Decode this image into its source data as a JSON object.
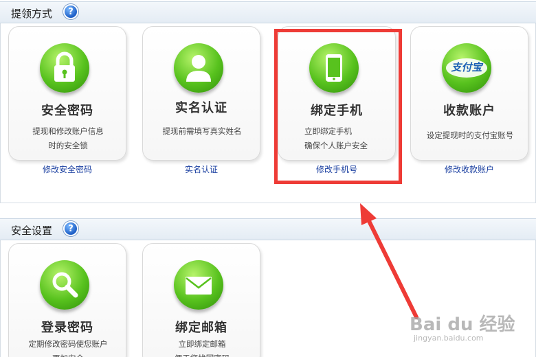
{
  "sections": [
    {
      "title": "提领方式",
      "help": "?",
      "cards": [
        {
          "title": "安全密码",
          "desc": [
            "提现和修改账户信息",
            "时的安全锁"
          ],
          "link": "修改安全密码",
          "icon": "lock-icon"
        },
        {
          "title": "实名认证",
          "desc": [
            "提现前需填写真实姓名"
          ],
          "link": "实名认证",
          "icon": "person-icon"
        },
        {
          "title": "绑定手机",
          "desc": [
            "立即绑定手机",
            "确保个人账户安全"
          ],
          "link": "修改手机号",
          "icon": "phone-icon"
        },
        {
          "title": "收款账户",
          "desc": [
            "设定提现时的支付宝账号"
          ],
          "link": "修改收款账户",
          "icon": "alipay-icon",
          "icon_text": "支付宝"
        }
      ]
    },
    {
      "title": "安全设置",
      "help": "?",
      "cards": [
        {
          "title": "登录密码",
          "desc": [
            "定期修改密码使您账户",
            "更加安全"
          ],
          "icon": "magnifier-icon"
        },
        {
          "title": "绑定邮箱",
          "desc": [
            "立即绑定邮箱",
            "便于您找回密码"
          ],
          "icon": "envelope-icon"
        }
      ]
    }
  ],
  "watermark": {
    "main": "Bai du 经验",
    "sub": "jingyan.baidu.com"
  },
  "colors": {
    "highlight": "#ee3b36",
    "link": "#1a3fa0",
    "icon_green": "#58c21e"
  }
}
